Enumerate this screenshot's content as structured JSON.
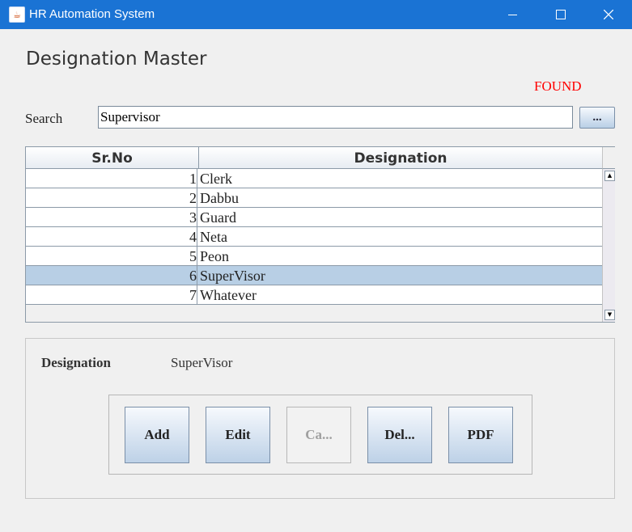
{
  "window": {
    "title": "HR Automation System",
    "app_icon": "java-coffee-icon",
    "controls": [
      "minimize-icon",
      "maximize-icon",
      "close-icon"
    ],
    "titlebar_color": "#1a73d4"
  },
  "page": {
    "title": "Designation Master",
    "status": "FOUND",
    "status_color": "#ff0000"
  },
  "search": {
    "label": "Search",
    "value": "Supervisor",
    "browse_label": "..."
  },
  "table": {
    "columns": [
      "Sr.No",
      "Designation"
    ],
    "rows": [
      {
        "sr": "1",
        "designation": "Clerk"
      },
      {
        "sr": "2",
        "designation": "Dabbu"
      },
      {
        "sr": "3",
        "designation": "Guard"
      },
      {
        "sr": "4",
        "designation": "Neta"
      },
      {
        "sr": "5",
        "designation": "Peon"
      },
      {
        "sr": "6",
        "designation": "SuperVisor"
      },
      {
        "sr": "7",
        "designation": "Whatever"
      }
    ],
    "selected_index": 5,
    "selected_color": "#b8cfe5"
  },
  "detail": {
    "label": "Designation",
    "value": "SuperVisor"
  },
  "buttons": {
    "add": "Add",
    "edit": "Edit",
    "cancel": "Ca...",
    "delete": "Del...",
    "pdf": "PDF"
  }
}
